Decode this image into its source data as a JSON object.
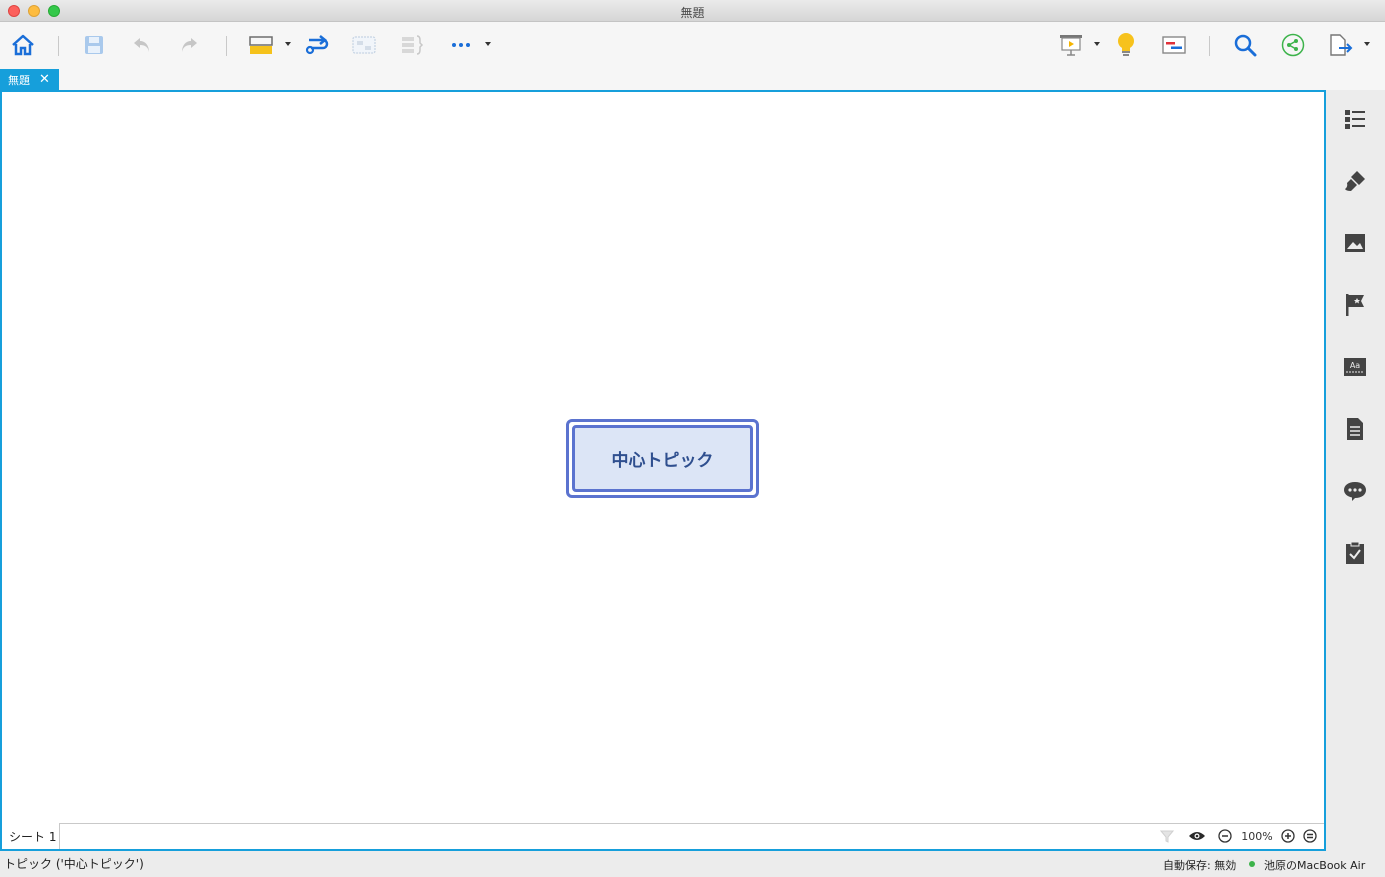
{
  "window": {
    "title": "無題"
  },
  "toolbar": {
    "home": "home-icon",
    "save": "save-icon",
    "undo": "undo-icon",
    "redo": "redo-icon",
    "insert_topic": "topic-icon",
    "relationship": "relationship-icon",
    "boundary": "boundary-icon",
    "summary": "summary-icon",
    "more": "more-icon",
    "presentation": "presentation-icon",
    "brainstorm": "lightbulb-icon",
    "gantt": "gantt-icon",
    "search": "search-icon",
    "share": "share-icon",
    "export": "export-icon"
  },
  "tabs": [
    {
      "label": "無題",
      "close": "✕"
    }
  ],
  "canvas": {
    "central_topic": "中心トピック"
  },
  "sheetbar": {
    "sheet_label": "シート 1",
    "zoom": "100%"
  },
  "statusbar": {
    "selection": "トピック ('中心トピック')",
    "autosave": "自動保存: 無効",
    "device": "池原のMacBook Air",
    "device_status_color": "#3cb34a"
  },
  "colors": {
    "accent": "#169fdb",
    "topic_border": "#5b73cf",
    "topic_fill": "#dce5f6",
    "topic_text": "#2f4f8f"
  },
  "right_panel": [
    "outline-icon",
    "format-icon",
    "image-icon",
    "marker-icon",
    "text-style-icon",
    "notes-icon",
    "comment-icon",
    "task-icon"
  ]
}
